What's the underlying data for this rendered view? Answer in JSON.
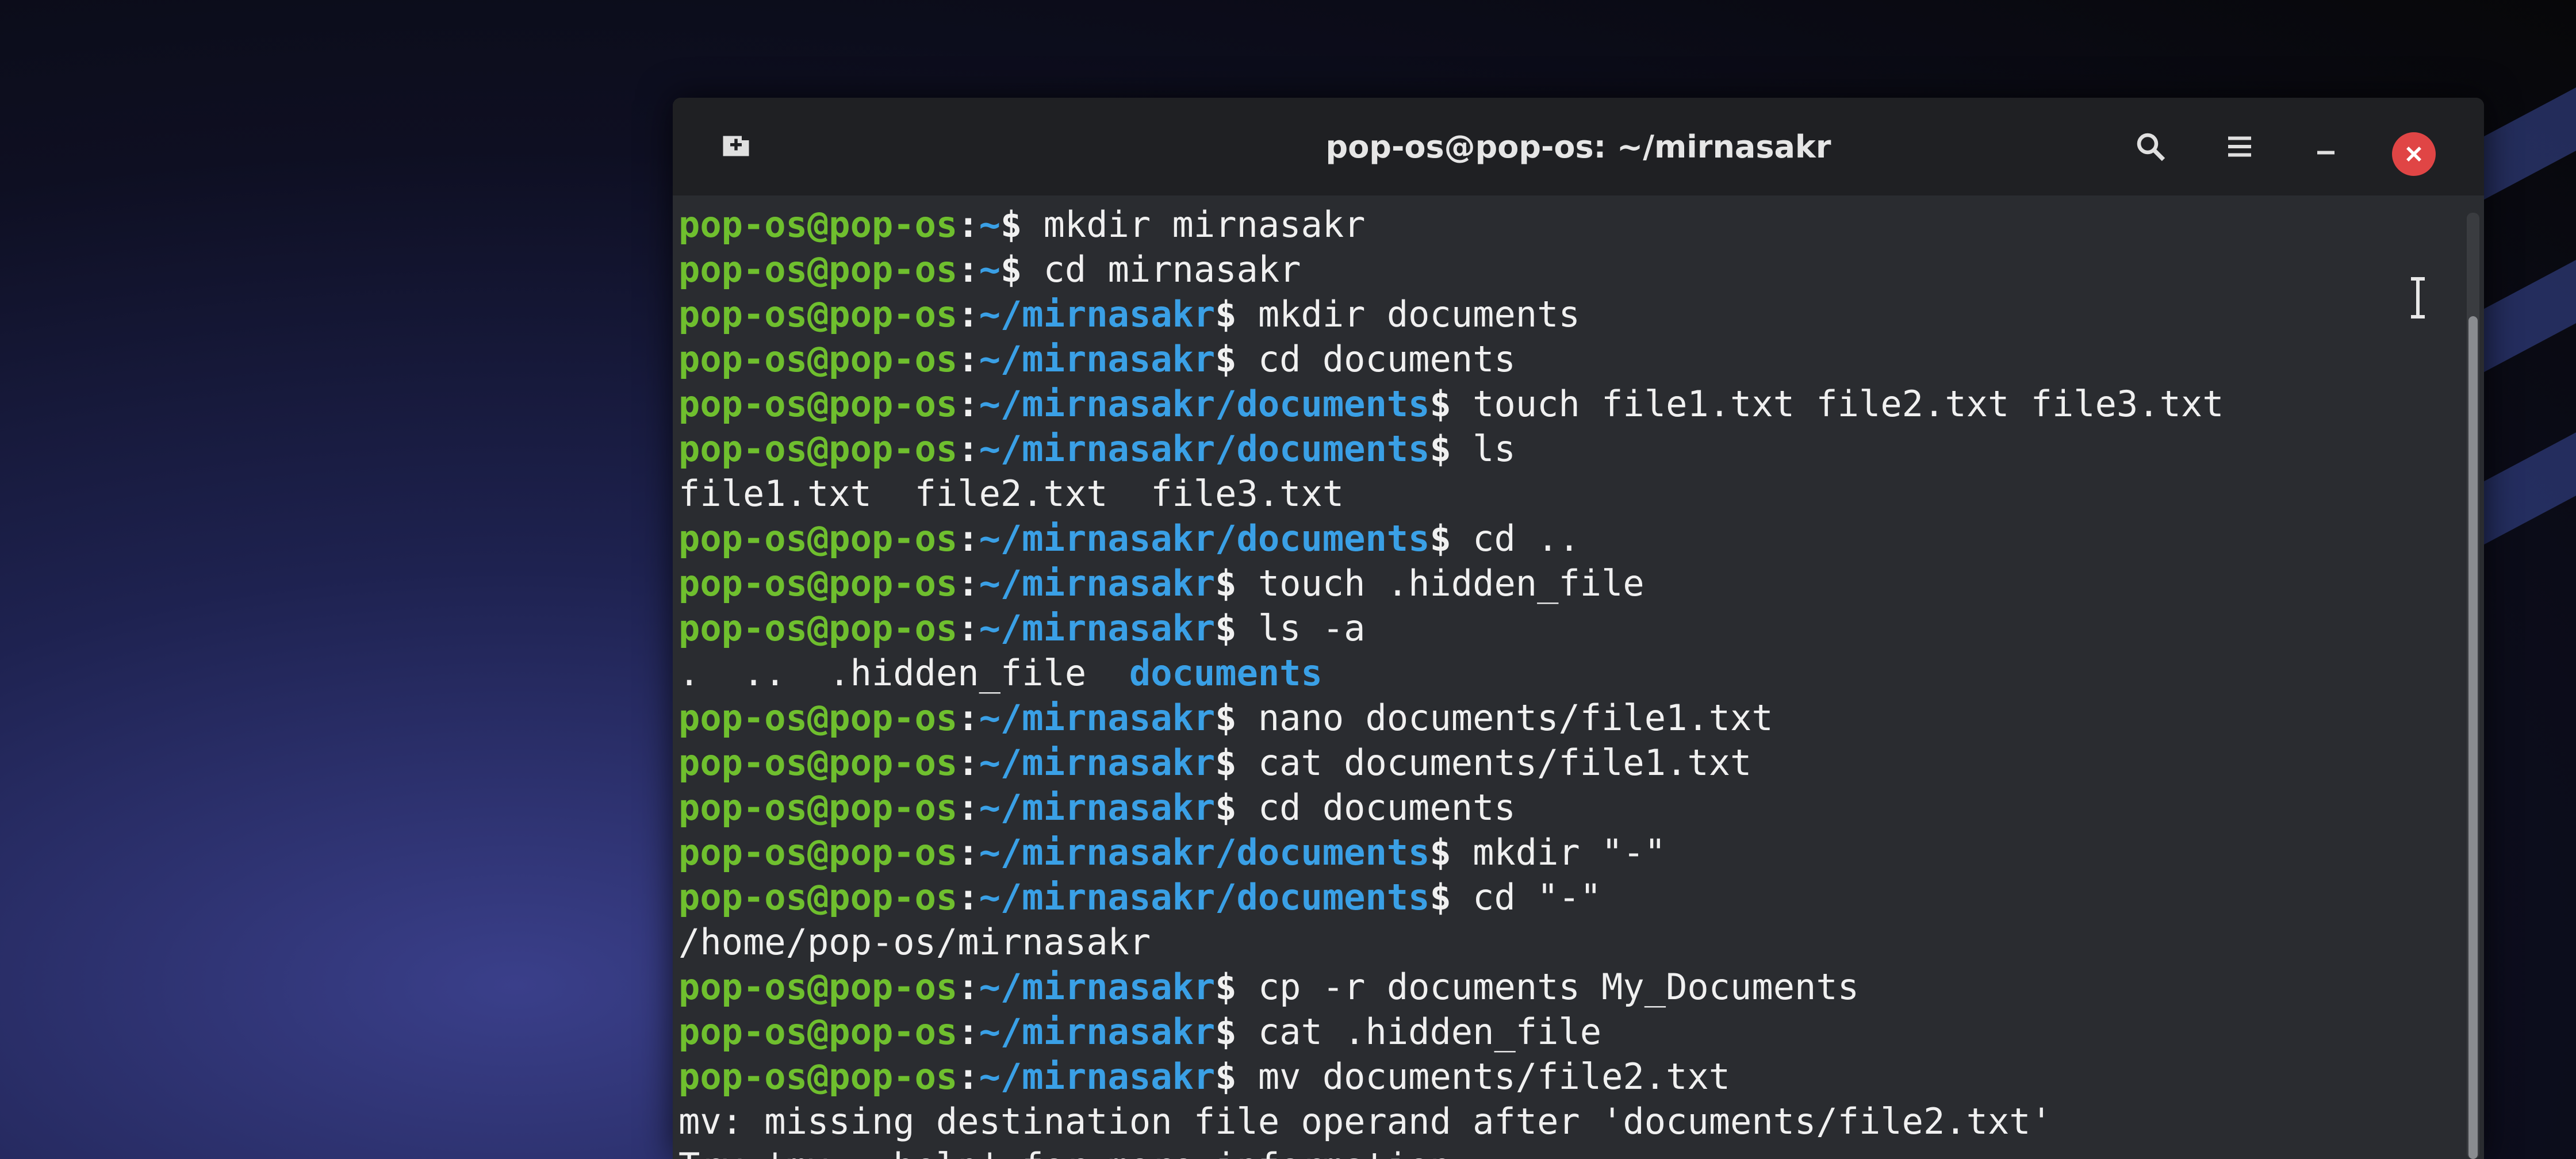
{
  "window": {
    "title": "pop-os@pop-os: ~/mirnasakr"
  },
  "icons": {
    "new_tab": "new-tab-icon",
    "search": "search-icon",
    "menu": "hamburger-menu-icon",
    "minimize": "minimize-icon",
    "close": "close-icon"
  },
  "colors": {
    "user_host": "#6fbf2e",
    "path": "#3aa0e6",
    "close_button": "#e04545",
    "terminal_bg": "#2a2c30"
  },
  "terminal": {
    "lines": [
      {
        "kind": "prompt",
        "user": "pop-os@pop-os",
        "path": "~",
        "cmd": "mkdir mirnasakr"
      },
      {
        "kind": "prompt",
        "user": "pop-os@pop-os",
        "path": "~",
        "cmd": "cd mirnasakr"
      },
      {
        "kind": "prompt",
        "user": "pop-os@pop-os",
        "path": "~/mirnasakr",
        "cmd": "mkdir documents"
      },
      {
        "kind": "prompt",
        "user": "pop-os@pop-os",
        "path": "~/mirnasakr",
        "cmd": "cd documents"
      },
      {
        "kind": "prompt",
        "user": "pop-os@pop-os",
        "path": "~/mirnasakr/documents",
        "cmd": "touch file1.txt file2.txt file3.txt"
      },
      {
        "kind": "prompt",
        "user": "pop-os@pop-os",
        "path": "~/mirnasakr/documents",
        "cmd": "ls"
      },
      {
        "kind": "output",
        "text": "file1.txt  file2.txt  file3.txt"
      },
      {
        "kind": "prompt",
        "user": "pop-os@pop-os",
        "path": "~/mirnasakr/documents",
        "cmd": "cd .."
      },
      {
        "kind": "prompt",
        "user": "pop-os@pop-os",
        "path": "~/mirnasakr",
        "cmd": "touch .hidden_file"
      },
      {
        "kind": "prompt",
        "user": "pop-os@pop-os",
        "path": "~/mirnasakr",
        "cmd": "ls -a"
      },
      {
        "kind": "ls",
        "plain": ".  ..  .hidden_file  ",
        "dir": "documents"
      },
      {
        "kind": "prompt",
        "user": "pop-os@pop-os",
        "path": "~/mirnasakr",
        "cmd": "nano documents/file1.txt"
      },
      {
        "kind": "prompt",
        "user": "pop-os@pop-os",
        "path": "~/mirnasakr",
        "cmd": "cat documents/file1.txt"
      },
      {
        "kind": "prompt",
        "user": "pop-os@pop-os",
        "path": "~/mirnasakr",
        "cmd": "cd documents"
      },
      {
        "kind": "prompt",
        "user": "pop-os@pop-os",
        "path": "~/mirnasakr/documents",
        "cmd": "mkdir \"-\""
      },
      {
        "kind": "prompt",
        "user": "pop-os@pop-os",
        "path": "~/mirnasakr/documents",
        "cmd": "cd \"-\""
      },
      {
        "kind": "output",
        "text": "/home/pop-os/mirnasakr"
      },
      {
        "kind": "prompt",
        "user": "pop-os@pop-os",
        "path": "~/mirnasakr",
        "cmd": "cp -r documents My_Documents"
      },
      {
        "kind": "prompt",
        "user": "pop-os@pop-os",
        "path": "~/mirnasakr",
        "cmd": "cat .hidden_file"
      },
      {
        "kind": "prompt",
        "user": "pop-os@pop-os",
        "path": "~/mirnasakr",
        "cmd": "mv documents/file2.txt"
      },
      {
        "kind": "output",
        "text": "mv: missing destination file operand after 'documents/file2.txt'"
      },
      {
        "kind": "output",
        "text": "Try 'mv --help' for more information."
      }
    ]
  }
}
